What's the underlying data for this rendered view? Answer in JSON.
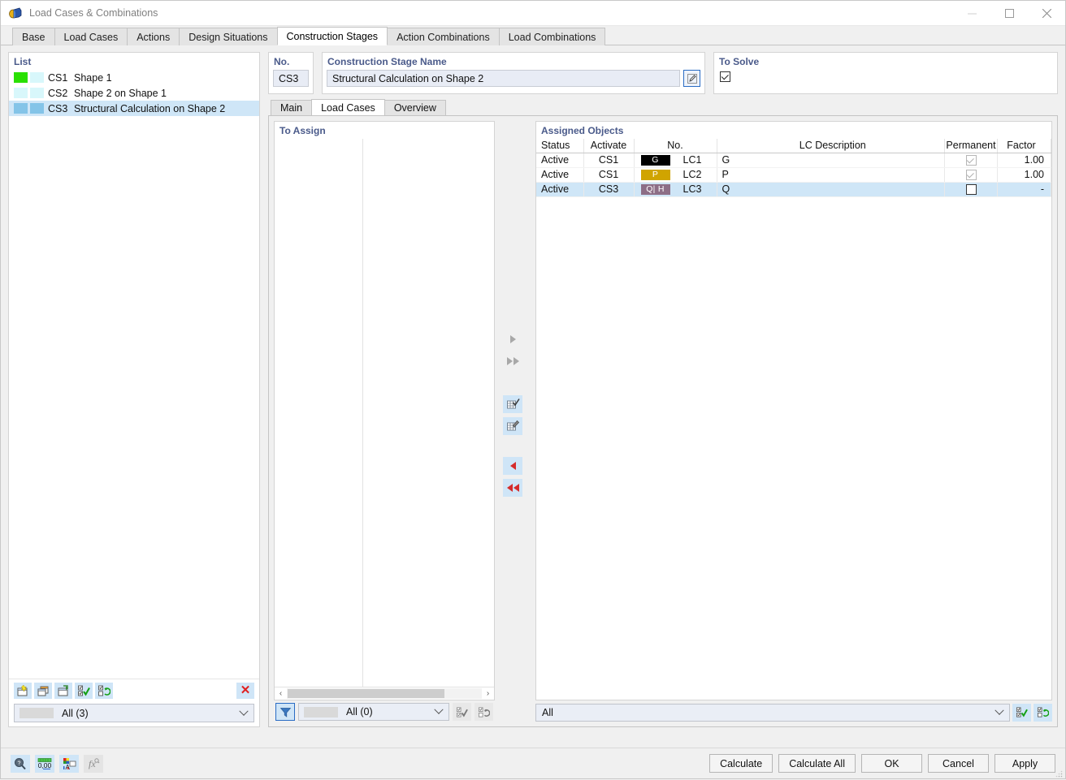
{
  "window": {
    "title": "Load Cases & Combinations",
    "icon": "app-icon",
    "minimize": "–",
    "maximize": "□",
    "close": "✕"
  },
  "tabs": [
    {
      "label": "Base",
      "active": false
    },
    {
      "label": "Load Cases",
      "active": false
    },
    {
      "label": "Actions",
      "active": false
    },
    {
      "label": "Design Situations",
      "active": false
    },
    {
      "label": "Construction Stages",
      "active": true
    },
    {
      "label": "Action Combinations",
      "active": false
    },
    {
      "label": "Load Combinations",
      "active": false
    }
  ],
  "list_panel": {
    "label": "List",
    "rows": [
      {
        "no": "CS1",
        "name": "Shape 1",
        "color1": "#2ae002",
        "color2": "#d8f7fb",
        "selected": false
      },
      {
        "no": "CS2",
        "name": "Shape 2 on Shape 1",
        "color1": "#d8f7fb",
        "color2": "#d8f7fb",
        "selected": false
      },
      {
        "no": "CS3",
        "name": "Structural Calculation on Shape 2",
        "color1": "#84c4e8",
        "color2": "#84c4e8",
        "selected": true
      }
    ],
    "toolbar": [
      {
        "name": "new-stage-button",
        "icon": "new-window-icon"
      },
      {
        "name": "copy-stage-button",
        "icon": "copy-window-icon"
      },
      {
        "name": "import-stage-button",
        "icon": "import-window-icon"
      },
      {
        "name": "select-all-button",
        "icon": "check-all-icon"
      },
      {
        "name": "invert-selection-button",
        "icon": "invert-selection-icon"
      }
    ],
    "delete_label": "✕",
    "filter": {
      "text": "All (3)",
      "swatch": "#d9d9d9"
    }
  },
  "stage_header": {
    "no_label": "No.",
    "no_value": "CS3",
    "name_label": "Construction Stage Name",
    "name_value": "Structural Calculation on Shape 2",
    "edit_icon": "edit-pencil-icon",
    "solve_label": "To Solve",
    "solve_checked": true
  },
  "inner_tabs": [
    {
      "label": "Main",
      "active": false
    },
    {
      "label": "Load Cases",
      "active": true
    },
    {
      "label": "Overview",
      "active": false
    }
  ],
  "to_assign": {
    "label": "To Assign",
    "rows": [],
    "scroll_left": "‹",
    "scroll_right": "›",
    "funnel_icon": "filter-funnel-icon",
    "combo": {
      "text": "All (0)",
      "swatch": "#d9d9d9"
    },
    "buttons": [
      {
        "name": "assign-select-all-button",
        "icon": "check-all-icon"
      },
      {
        "name": "assign-invert-selection-button",
        "icon": "invert-selection-icon"
      }
    ]
  },
  "transfer_buttons": [
    {
      "name": "assign-one-button",
      "icon": "arrow-right-icon",
      "enabled": false
    },
    {
      "name": "assign-all-button",
      "icon": "double-arrow-right-icon",
      "enabled": false
    },
    {
      "name": "edit-table-button",
      "icon": "table-check-icon",
      "enabled": true
    },
    {
      "name": "settings-table-button",
      "icon": "table-wrench-icon",
      "enabled": true
    },
    {
      "name": "unassign-one-button",
      "icon": "arrow-left-icon",
      "enabled": true
    },
    {
      "name": "unassign-all-button",
      "icon": "double-arrow-left-icon",
      "enabled": true
    }
  ],
  "assigned_objects": {
    "label": "Assigned Objects",
    "columns": [
      "Status",
      "Activate",
      "No.",
      "LC Description",
      "Permanent",
      "Factor"
    ],
    "rows": [
      {
        "status": "Active",
        "activate": "CS1",
        "badge_text": "G",
        "badge_bg": "#000000",
        "badge_fg": "#ffffff",
        "no": "LC1",
        "description": "G",
        "permanent": true,
        "permanent_enabled": false,
        "factor": "1.00",
        "selected": false
      },
      {
        "status": "Active",
        "activate": "CS1",
        "badge_text": "P",
        "badge_bg": "#d0a400",
        "badge_fg": "#ffffff",
        "no": "LC2",
        "description": "P",
        "permanent": true,
        "permanent_enabled": false,
        "factor": "1.00",
        "selected": false
      },
      {
        "status": "Active",
        "activate": "CS3",
        "badge_text": "Q| H",
        "badge_bg": "#8d6e86",
        "badge_fg": "#ffffff",
        "no": "LC3",
        "description": "Q",
        "permanent": false,
        "permanent_enabled": true,
        "factor": "-",
        "selected": true
      }
    ],
    "filter_text": "All",
    "buttons": [
      {
        "name": "assigned-select-all-button",
        "icon": "check-all-icon"
      },
      {
        "name": "assigned-invert-selection-button",
        "icon": "invert-selection-icon"
      }
    ]
  },
  "bottom_bar": {
    "icons": [
      {
        "name": "magnifier-button",
        "icon": "magnifier-icon",
        "enabled": true
      },
      {
        "name": "units-button",
        "icon": "decimal-units-icon",
        "enabled": true
      },
      {
        "name": "display-properties-button",
        "icon": "color-palette-icon",
        "enabled": true
      },
      {
        "name": "formula-button",
        "icon": "function-fx-icon",
        "enabled": false
      }
    ],
    "buttons": [
      {
        "label": "Calculate",
        "name": "calculate-button"
      },
      {
        "label": "Calculate All",
        "name": "calculate-all-button"
      },
      {
        "label": "OK",
        "name": "ok-button"
      },
      {
        "label": "Cancel",
        "name": "cancel-button"
      },
      {
        "label": "Apply",
        "name": "apply-button"
      }
    ]
  }
}
